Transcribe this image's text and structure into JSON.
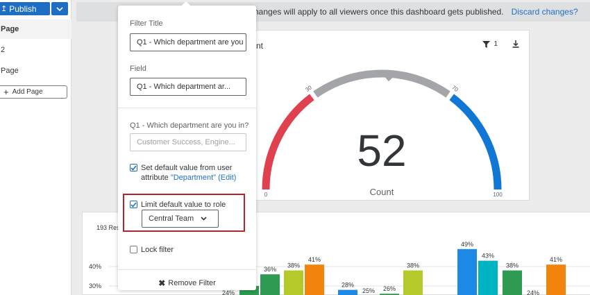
{
  "sidebar": {
    "publish_label": "Publish",
    "items": [
      {
        "label": "Page",
        "active": true
      },
      {
        "label": "2"
      },
      {
        "label": "Page"
      }
    ],
    "add_page_label": "Add Page"
  },
  "notice": {
    "text": "hanges will apply to all viewers once this dashboard gets published.",
    "discard_label": "Discard changes?"
  },
  "gauge_widget": {
    "title": "nt",
    "filter_count": "1",
    "value_label": "52",
    "metric_label": "Count",
    "colors": {
      "low": "#e0414f",
      "mid": "#a3a5a8",
      "high": "#1078d4",
      "marker": "#a3a5a8"
    }
  },
  "bar_widget": {
    "responses_label": "193 Res"
  },
  "filter_panel": {
    "filter_title_label": "Filter Title",
    "filter_title_value": "Q1 - Which department are you",
    "field_label": "Field",
    "field_value": "Q1 - Which department ar...",
    "question_label": "Q1 - Which department are you in?",
    "question_placeholder": "Customer Success, Engine...",
    "default_attr_checked": true,
    "default_attr_text": "Set default value from user attribute ",
    "default_attr_link": "\"Department\" (Edit)",
    "limit_role_checked": true,
    "limit_role_label": "Limit default value to role",
    "role_value": "Central Team",
    "lock_filter_checked": false,
    "lock_filter_label": "Lock filter",
    "remove_filter_label": "Remove Filter"
  },
  "chart_data": [
    {
      "type": "gauge",
      "value": 52,
      "min": 0,
      "max": 100,
      "thresholds": [
        30,
        70
      ],
      "tick_labels": [
        "0",
        "30",
        "70",
        "100"
      ],
      "label": "Count"
    },
    {
      "type": "bar",
      "y_ticks": [
        "40%",
        "30%"
      ],
      "ylim": [
        0,
        50
      ],
      "bars": [
        {
          "value": 24,
          "label": "24%",
          "color": "#2f96c4",
          "partial": true
        },
        {
          "value": 30,
          "label": "",
          "color": "#2e9a52"
        },
        {
          "value": 36,
          "label": "36%",
          "color": "#2e9a52"
        },
        {
          "value": 38,
          "label": "38%",
          "color": "#b6c92b"
        },
        {
          "value": 41,
          "label": "41%",
          "color": "#f2830d"
        },
        {
          "value": 28,
          "label": "28%",
          "color": "#1e88e5"
        },
        {
          "value": 25,
          "label": "25%",
          "color": "#00b3c3"
        },
        {
          "value": 26,
          "label": "26%",
          "color": "#2e9a52"
        },
        {
          "value": 38,
          "label": "38%",
          "color": "#b6c92b"
        },
        {
          "value": 49,
          "label": "49%",
          "color": "#1e88e5"
        },
        {
          "value": 43,
          "label": "43%",
          "color": "#00b3c3"
        },
        {
          "value": 38,
          "label": "38%",
          "color": "#2e9a52"
        },
        {
          "value": 24,
          "label": "24%",
          "color": "#b6c92b"
        },
        {
          "value": 41,
          "label": "41%",
          "color": "#f2830d"
        }
      ]
    }
  ]
}
